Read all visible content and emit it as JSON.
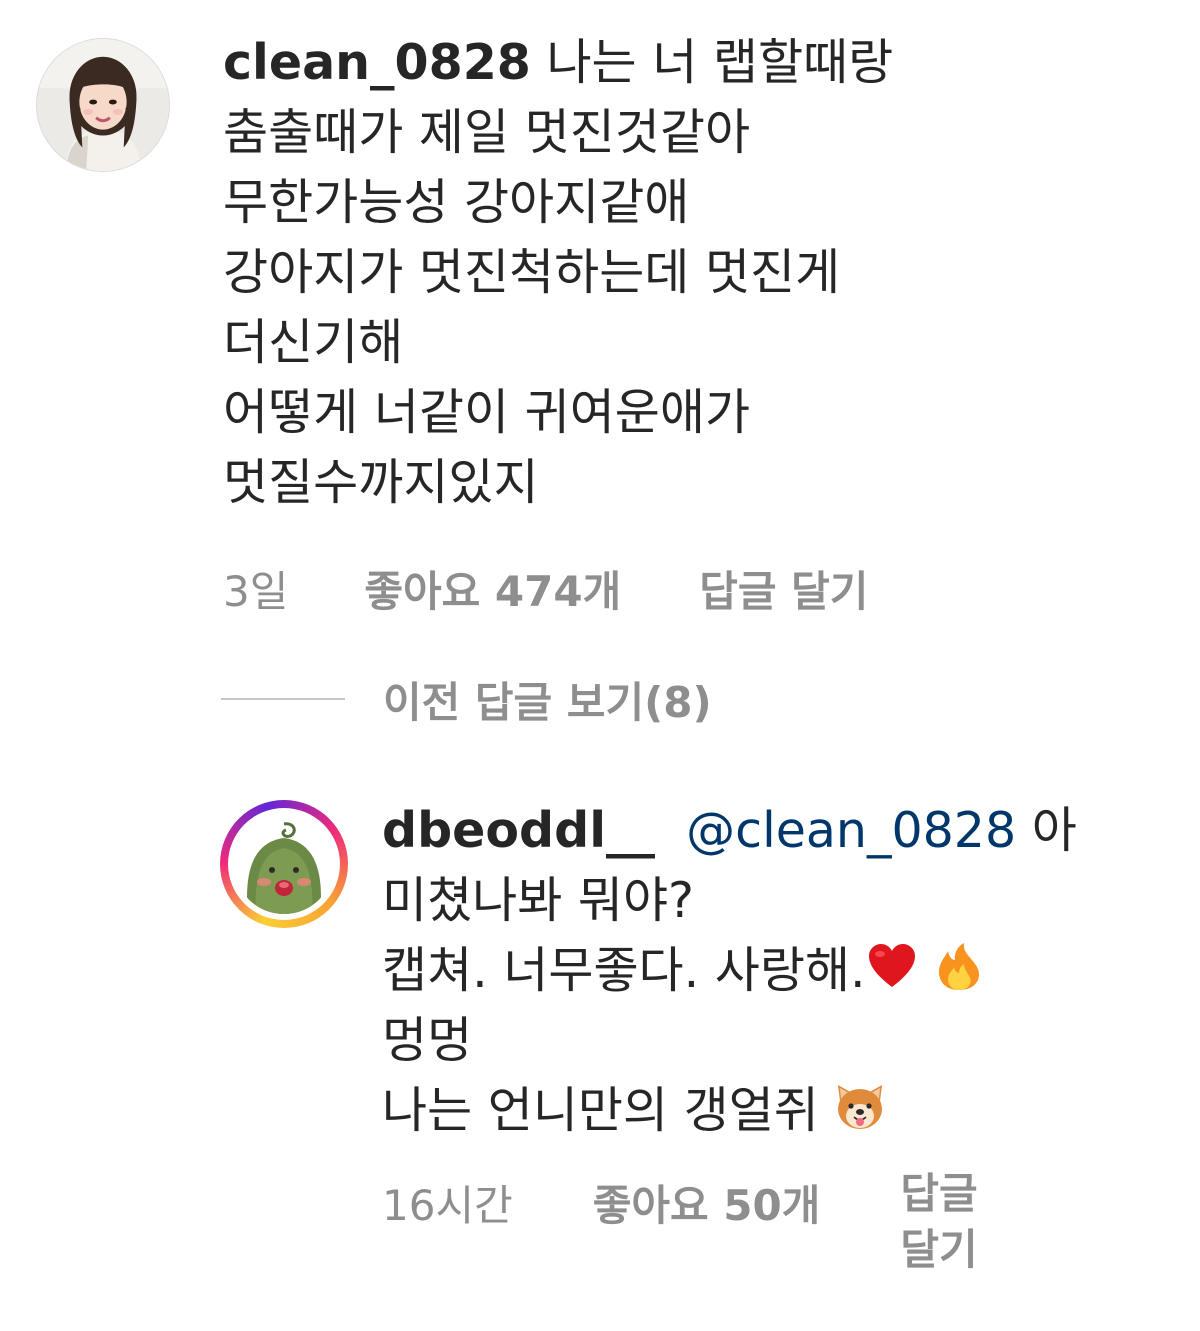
{
  "main_comment": {
    "username": "clean_0828",
    "lines": [
      " 나는 너 랩할때랑",
      "춤출때가 제일 멋진것같아",
      "무한가능성 강아지같애",
      "강아지가 멋진척하는데 멋진게",
      "더신기해",
      "어떻게 너같이 귀여운애가",
      "멋질수까지있지"
    ],
    "time": "3일",
    "likes": "좋아요 474개",
    "reply_action": "답글 달기"
  },
  "view_replies": {
    "label": "이전 답글 보기(8)"
  },
  "reply_comment": {
    "username": "dbeoddl__",
    "mention": "@clean_0828",
    "first_line_rest": " 아",
    "lines": [
      "미쳤나봐 뭐야?",
      "캡쳐. 너무좋다. 사랑해.",
      "멍멍",
      "나는 언니만의 갱얼쥐 "
    ],
    "emojis": {
      "line2": [
        "red-heart-icon",
        "fire-icon"
      ],
      "line4": [
        "dog-face-icon"
      ]
    },
    "time": "16시간",
    "likes": "좋아요 50개",
    "reply_action": "답글\n달기"
  },
  "colors": {
    "text": "#262626",
    "secondary": "#8e8e8e",
    "mention": "#00376b",
    "story_ring": [
      "#f9ce34",
      "#ee2a7b",
      "#6228d7"
    ]
  }
}
